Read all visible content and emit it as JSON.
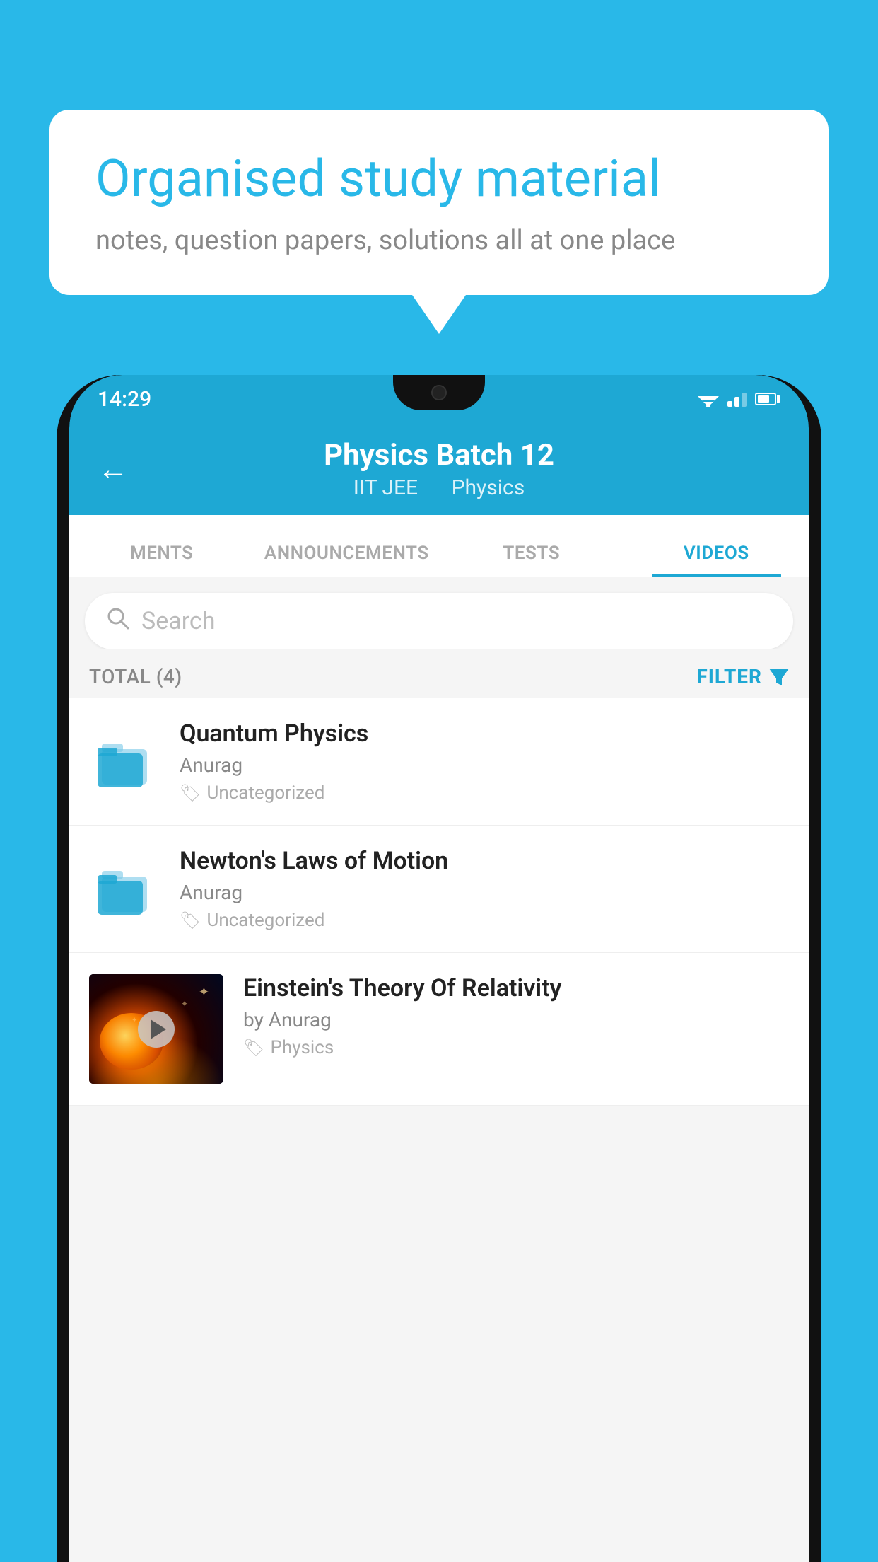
{
  "background_color": "#29b8e8",
  "speech_bubble": {
    "title": "Organised study material",
    "subtitle": "notes, question papers, solutions all at one place"
  },
  "status_bar": {
    "time": "14:29"
  },
  "app_bar": {
    "title": "Physics Batch 12",
    "subtitle_left": "IIT JEE",
    "subtitle_right": "Physics",
    "back_label": "←"
  },
  "tabs": [
    {
      "label": "MENTS",
      "active": false
    },
    {
      "label": "ANNOUNCEMENTS",
      "active": false
    },
    {
      "label": "TESTS",
      "active": false
    },
    {
      "label": "VIDEOS",
      "active": true
    }
  ],
  "search": {
    "placeholder": "Search"
  },
  "total": {
    "label": "TOTAL (4)",
    "filter_label": "FILTER"
  },
  "videos": [
    {
      "title": "Quantum Physics",
      "author": "Anurag",
      "tag": "Uncategorized",
      "has_thumb": false
    },
    {
      "title": "Newton's Laws of Motion",
      "author": "Anurag",
      "tag": "Uncategorized",
      "has_thumb": false
    },
    {
      "title": "Einstein's Theory Of Relativity",
      "author": "by Anurag",
      "tag": "Physics",
      "has_thumb": true
    }
  ]
}
